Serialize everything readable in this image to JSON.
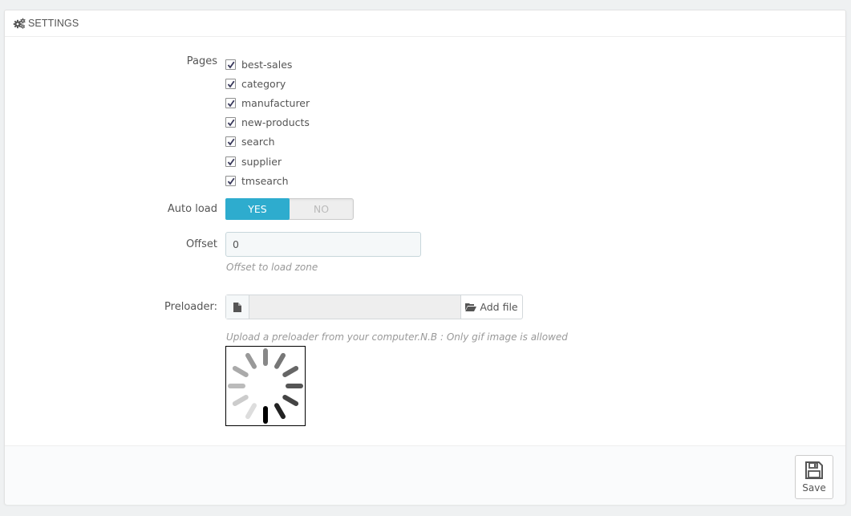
{
  "panel": {
    "title": "Settings",
    "title_icon": "cogs-icon"
  },
  "pages": {
    "label": "Pages",
    "items": [
      {
        "label": "best-sales",
        "checked": true
      },
      {
        "label": "category",
        "checked": true
      },
      {
        "label": "manufacturer",
        "checked": true
      },
      {
        "label": "new-products",
        "checked": true
      },
      {
        "label": "search",
        "checked": true
      },
      {
        "label": "supplier",
        "checked": true
      },
      {
        "label": "tmsearch",
        "checked": true
      }
    ]
  },
  "auto_load": {
    "label": "Auto load",
    "yes_label": "YES",
    "no_label": "NO",
    "value": "YES"
  },
  "offset": {
    "label": "Offset",
    "value": "0",
    "help": "Offset to load zone"
  },
  "preloader": {
    "label": "Preloader:",
    "file_icon": "file-icon",
    "add_file_label": "Add file",
    "add_file_icon": "folder-open-icon",
    "help": "Upload a preloader from your computer.N.B : Only gif image is allowed",
    "preview_icon": "spinner-icon"
  },
  "footer": {
    "save_label": "Save",
    "save_icon": "floppy-disk-icon"
  },
  "colors": {
    "accent": "#2eacce",
    "background": "#eff1f2"
  }
}
